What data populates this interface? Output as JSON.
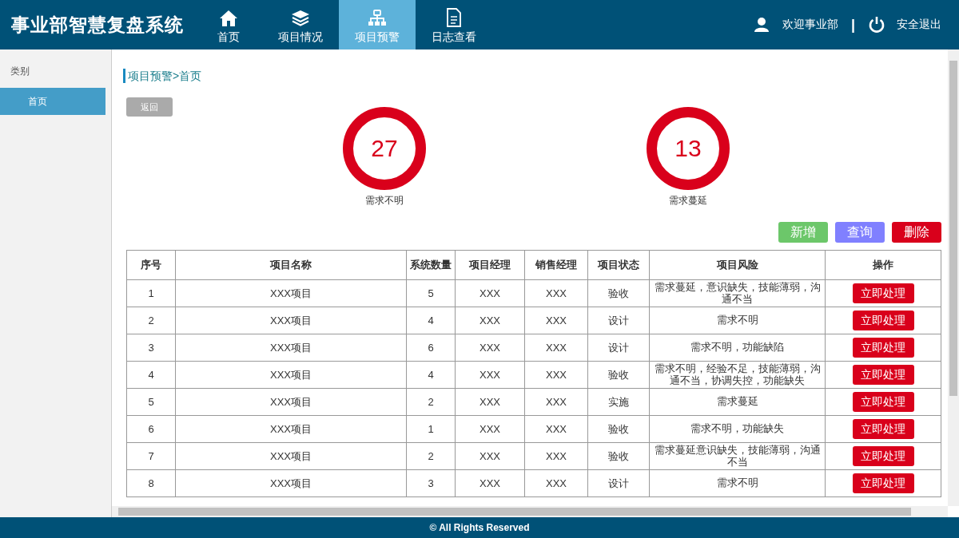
{
  "app_title": "事业部智慧复盘系统",
  "nav": [
    {
      "label": "首页",
      "selected": false
    },
    {
      "label": "项目情况",
      "selected": false
    },
    {
      "label": "项目预警",
      "selected": true
    },
    {
      "label": "日志查看",
      "selected": false
    }
  ],
  "user": {
    "welcome": "欢迎事业部",
    "separator": "|",
    "logout": "安全退出"
  },
  "sidebar": {
    "heading": "类别",
    "items": [
      {
        "label": "首页",
        "selected": true
      }
    ]
  },
  "breadcrumb": "项目预警>首页",
  "back_button": "返回",
  "stats": [
    {
      "value": "27",
      "label": "需求不明"
    },
    {
      "value": "13",
      "label": "需求蔓延"
    }
  ],
  "actions": [
    {
      "label": "新增",
      "color": "#6cc76a"
    },
    {
      "label": "查询",
      "color": "#8080ff"
    },
    {
      "label": "删除",
      "color": "#d9001b"
    }
  ],
  "table": {
    "columns": [
      "序号",
      "项目名称",
      "系统数量",
      "项目经理",
      "销售经理",
      "项目状态",
      "项目风险",
      "操作"
    ],
    "rows": [
      {
        "no": "1",
        "name": "XXX项目",
        "systems": "5",
        "pm": "XXX",
        "sales": "XXX",
        "status": "验收",
        "risk": "需求蔓延，意识缺失，技能薄弱，沟通不当",
        "action": "立即处理"
      },
      {
        "no": "2",
        "name": "XXX项目",
        "systems": "4",
        "pm": "XXX",
        "sales": "XXX",
        "status": "设计",
        "risk": "需求不明",
        "action": "立即处理"
      },
      {
        "no": "3",
        "name": "XXX项目",
        "systems": "6",
        "pm": "XXX",
        "sales": "XXX",
        "status": "设计",
        "risk": "需求不明，功能缺陷",
        "action": "立即处理"
      },
      {
        "no": "4",
        "name": "XXX项目",
        "systems": "4",
        "pm": "XXX",
        "sales": "XXX",
        "status": "验收",
        "risk": "需求不明，经验不足，技能薄弱，沟通不当，协调失控，功能缺失",
        "action": "立即处理"
      },
      {
        "no": "5",
        "name": "XXX项目",
        "systems": "2",
        "pm": "XXX",
        "sales": "XXX",
        "status": "实施",
        "risk": "需求蔓延",
        "action": "立即处理"
      },
      {
        "no": "6",
        "name": "XXX项目",
        "systems": "1",
        "pm": "XXX",
        "sales": "XXX",
        "status": "验收",
        "risk": "需求不明，功能缺失",
        "action": "立即处理"
      },
      {
        "no": "7",
        "name": "XXX项目",
        "systems": "2",
        "pm": "XXX",
        "sales": "XXX",
        "status": "验收",
        "risk": "需求蔓延意识缺失，技能薄弱，沟通不当",
        "action": "立即处理"
      },
      {
        "no": "8",
        "name": "XXX项目",
        "systems": "3",
        "pm": "XXX",
        "sales": "XXX",
        "status": "设计",
        "risk": "需求不明",
        "action": "立即处理"
      }
    ]
  },
  "footer": "© All Rights Reserved"
}
